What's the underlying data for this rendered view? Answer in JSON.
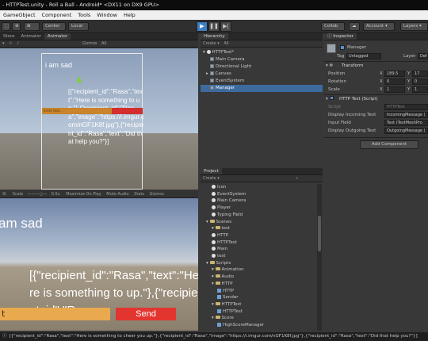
{
  "titlebar": {
    "title": "- HTTPTest.unity - Roll a Ball - Android* <DX11 on DX9 GPU>"
  },
  "menu": [
    "GameObject",
    "Component",
    "Tools",
    "Window",
    "Help"
  ],
  "toolbar": {
    "pivot_label": "Center",
    "space_label": "Local",
    "collab_label": "Collab",
    "account_label": "Account",
    "layers_label": "Layers"
  },
  "scene": {
    "tabs": [
      "Store",
      "Animator",
      "Animator"
    ],
    "gizmos_label": "Gizmos",
    "all_label": "All",
    "title_text": "i am sad",
    "json_text": "[{\"recipient_id\":\"Rasa\",\"text\":\"Here is something to up.\"},{\"recipient_id\":\"Rasa\",\"image\":\"https://i.imgur.com/nGF1K8f.jpg\"},{\"recipient_id\":\"Rasa\",\"text\":\"Did that help you?\"}]",
    "input_label": "Enter text..."
  },
  "game": {
    "scale_label": "Scale",
    "scale_value": "0.5x",
    "options": [
      "Maximize On Play",
      "Mute Audio",
      "Stats",
      "Gizmos"
    ],
    "title_text": "am sad",
    "json_text": "[{\"recipient_id\":\"Rasa\",\"text\":\"Here is something to up.\"},{\"recipient_id\":\"Ras",
    "input_text": "t",
    "send_label": "Send"
  },
  "hierarchy": {
    "tab": "Hierarchy",
    "create_label": "Create",
    "search_placeholder": "All",
    "scene_name": "HTTPTest*",
    "items": [
      "Main Camera",
      "Directional Light",
      "Canvas",
      "EventSystem",
      "Manager"
    ]
  },
  "project": {
    "tab": "Project",
    "create_label": "Create",
    "items": [
      {
        "label": "Icon",
        "kind": "unity",
        "indent": 2
      },
      {
        "label": "EventSystem",
        "kind": "unity",
        "indent": 2
      },
      {
        "label": "Main Camera",
        "kind": "unity",
        "indent": 2
      },
      {
        "label": "Player",
        "kind": "unity",
        "indent": 2
      },
      {
        "label": "Typing Field",
        "kind": "unity",
        "indent": 2
      },
      {
        "label": "Scenes",
        "kind": "folder",
        "indent": 1
      },
      {
        "label": "test",
        "kind": "folder",
        "indent": 2
      },
      {
        "label": "HTTP",
        "kind": "unity",
        "indent": 2
      },
      {
        "label": "HTTPTest",
        "kind": "unity",
        "indent": 2
      },
      {
        "label": "Main",
        "kind": "unity",
        "indent": 2
      },
      {
        "label": "test",
        "kind": "unity",
        "indent": 2
      },
      {
        "label": "Scripts",
        "kind": "folder",
        "indent": 1
      },
      {
        "label": "Animation",
        "kind": "folder",
        "indent": 2
      },
      {
        "label": "Audio",
        "kind": "folder",
        "indent": 2
      },
      {
        "label": "HTTP",
        "kind": "folder",
        "indent": 2
      },
      {
        "label": "HTTP",
        "kind": "script",
        "indent": 3
      },
      {
        "label": "Sender",
        "kind": "script",
        "indent": 3
      },
      {
        "label": "HTTPTest",
        "kind": "folder",
        "indent": 2
      },
      {
        "label": "HTTPTest",
        "kind": "script",
        "indent": 3
      },
      {
        "label": "Score",
        "kind": "folder",
        "indent": 2
      },
      {
        "label": "HighScoreManager",
        "kind": "script",
        "indent": 3
      }
    ]
  },
  "inspector": {
    "tab": "Inspector",
    "object_name": "Manager",
    "tag_label": "Tag",
    "tag_value": "Untagged",
    "layer_label": "Layer",
    "layer_value": "Def",
    "transform_title": "Transform",
    "position_label": "Position",
    "position_x": "189.5",
    "position_y": "17",
    "rotation_label": "Rotation",
    "rotation_x": "0",
    "rotation_y": "0",
    "scale_label": "Scale",
    "scale_x": "1",
    "scale_y": "1",
    "component_title": "HTTP Test (Script)",
    "script_label": "Script",
    "script_value": "HTTPTest",
    "incoming_label": "Display Incoming Text",
    "incoming_value": "IncomingMessage (",
    "input_label": "Input Field",
    "input_value": "Text (TextMeshPro",
    "outgoing_label": "Display Outgoing Text",
    "outgoing_value": "OutgoingMessage (",
    "add_component_label": "Add Component"
  },
  "status": {
    "text": "[{\"recipient_id\":\"Rasa\",\"text\":\"Here is something to cheer you up.\"},{\"recipient_id\":\"Rasa\",\"image\":\"https://i.imgur.com/nGF1K8f.jpg\"},{\"recipient_id\":\"Rasa\",\"text\":\"Did that help you?\"}]"
  },
  "colors": {
    "accent": "#3d7fc4",
    "send_button": "#e3352f",
    "input_field": "#e9a94f",
    "hierarchy_selection": "#3d6b9e"
  }
}
